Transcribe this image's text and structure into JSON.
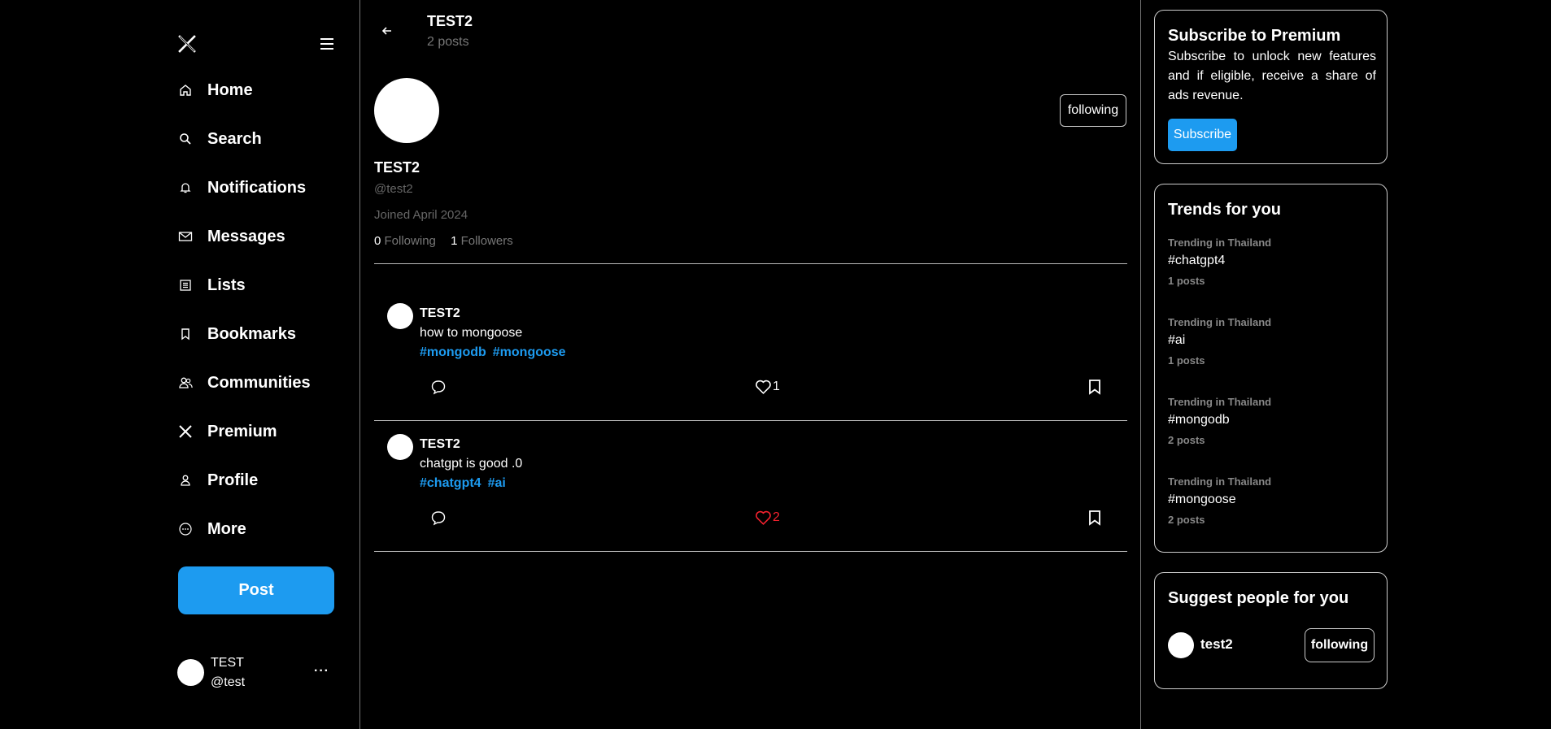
{
  "sidebar": {
    "logo": "x-logo-icon",
    "menu_icon": "hamburger-icon",
    "items": [
      {
        "label": "Home",
        "icon": "home-icon"
      },
      {
        "label": "Search",
        "icon": "search-icon"
      },
      {
        "label": "Notifications",
        "icon": "bell-icon"
      },
      {
        "label": "Messages",
        "icon": "mail-icon"
      },
      {
        "label": "Lists",
        "icon": "list-icon"
      },
      {
        "label": "Bookmarks",
        "icon": "bookmark-icon"
      },
      {
        "label": "Communities",
        "icon": "people-icon"
      },
      {
        "label": "Premium",
        "icon": "x-icon"
      },
      {
        "label": "Profile",
        "icon": "person-icon"
      },
      {
        "label": "More",
        "icon": "more-circle-icon"
      }
    ],
    "post_label": "Post",
    "account": {
      "name": "TEST",
      "handle": "@test",
      "more": "···"
    }
  },
  "header": {
    "name": "TEST2",
    "post_count": "2 posts"
  },
  "profile": {
    "name": "TEST2",
    "handle": "@test2",
    "joined": "Joined April 2024",
    "following_count": "0",
    "following_label": "Following",
    "followers_count": "1",
    "followers_label": "Followers",
    "follow_button": "following"
  },
  "tweets": [
    {
      "author": "TEST2",
      "text": "how to mongoose",
      "tags": [
        "#mongodb",
        "#mongoose"
      ],
      "likes": "1",
      "liked": false
    },
    {
      "author": "TEST2",
      "text": "chatgpt is good .0",
      "tags": [
        "#chatgpt4",
        "#ai"
      ],
      "likes": "2",
      "liked": true
    }
  ],
  "premium": {
    "title": "Subscribe to Premium",
    "text": "Subscribe to unlock new features and if eligible, receive a share of ads revenue.",
    "button": "Subscribe"
  },
  "trends": {
    "title": "Trends for you",
    "items": [
      {
        "context": "Trending in Thailand",
        "tag": "#chatgpt4",
        "count": "1 posts"
      },
      {
        "context": "Trending in Thailand",
        "tag": "#ai",
        "count": "1 posts"
      },
      {
        "context": "Trending in Thailand",
        "tag": "#mongodb",
        "count": "2 posts"
      },
      {
        "context": "Trending in Thailand",
        "tag": "#mongoose",
        "count": "2 posts"
      }
    ]
  },
  "suggest": {
    "title": "Suggest people for you",
    "people": [
      {
        "name": "test2",
        "button": "following"
      }
    ]
  },
  "colors": {
    "accent": "#1d9bf0",
    "liked": "#f4212e",
    "muted": "#777777"
  }
}
